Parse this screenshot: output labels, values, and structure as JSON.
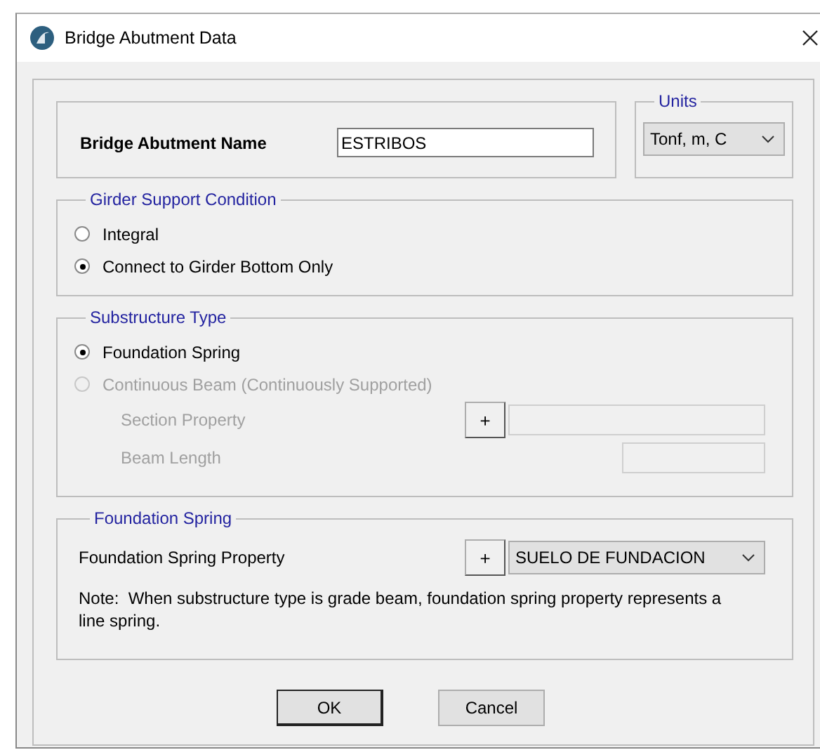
{
  "window": {
    "title": "Bridge Abutment Data"
  },
  "name": {
    "label": "Bridge Abutment Name",
    "value": "ESTRIBOS"
  },
  "units": {
    "title": "Units",
    "value": "Tonf, m, C"
  },
  "girder_support": {
    "title": "Girder Support Condition",
    "options": [
      {
        "label": "Integral",
        "selected": false,
        "disabled": false
      },
      {
        "label": "Connect to Girder Bottom Only",
        "selected": true,
        "disabled": false
      }
    ]
  },
  "substructure": {
    "title": "Substructure Type",
    "options": [
      {
        "label": "Foundation Spring",
        "selected": true,
        "disabled": false
      },
      {
        "label": "Continuous Beam (Continuously Supported)",
        "selected": false,
        "disabled": true
      }
    ],
    "fields": [
      {
        "kind": "add",
        "label": "Section Property",
        "button": "+",
        "disabled": true
      },
      {
        "kind": "text",
        "label": "Beam Length",
        "disabled": true
      }
    ]
  },
  "foundation_spring": {
    "title": "Foundation Spring",
    "label": "Foundation Spring Property",
    "button": "+",
    "value": "SUELO DE FUNDACION",
    "note": "Note:  When substructure type is grade beam, foundation spring property represents a line spring."
  },
  "buttons": [
    {
      "label": "OK",
      "default": true
    },
    {
      "label": "Cancel",
      "default": false
    }
  ]
}
